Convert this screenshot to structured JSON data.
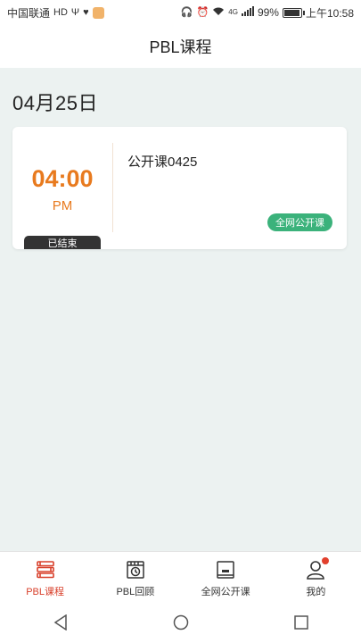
{
  "status_bar": {
    "carrier": "中国联通",
    "hd_label": "HD",
    "network_label": "4G",
    "battery_percent": "99%",
    "battery_level": 0.99,
    "time": "上午10:58"
  },
  "header": {
    "title": "PBL课程"
  },
  "date_heading": "04月25日",
  "courses": [
    {
      "time": "04:00",
      "ampm": "PM",
      "status": "已结束",
      "title": "公开课0425",
      "tag": "全网公开课"
    }
  ],
  "bottom_nav": [
    {
      "label": "PBL课程",
      "icon": "course-books-icon",
      "active": true
    },
    {
      "label": "PBL回顾",
      "icon": "review-calendar-icon",
      "active": false
    },
    {
      "label": "全网公开课",
      "icon": "public-course-icon",
      "active": false
    },
    {
      "label": "我的",
      "icon": "profile-icon",
      "active": false,
      "badge": true
    }
  ],
  "colors": {
    "accent_red": "#d8402b",
    "time_orange": "#e87a1e",
    "tag_green": "#3bb27b",
    "background": "#ecf2f1"
  }
}
